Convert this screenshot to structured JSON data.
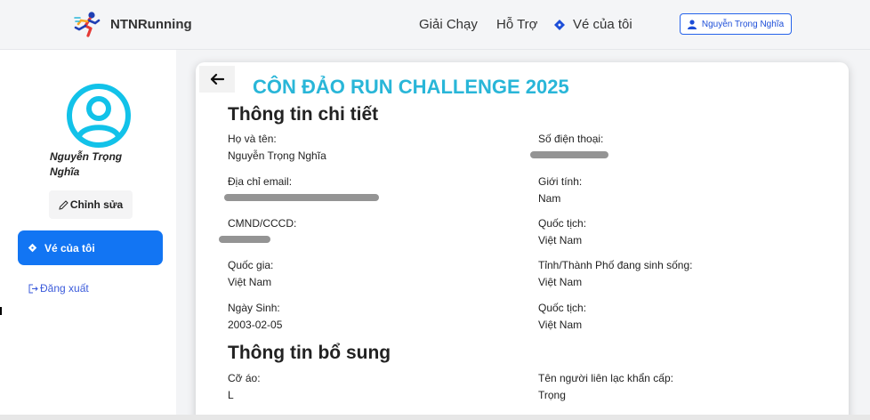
{
  "header": {
    "brand": "NTNRunning",
    "nav": {
      "races": "Giải Chạy",
      "support": "Hỗ Trợ",
      "my_tickets": "Vé của tôi"
    },
    "user_button": "Nguyễn Trọng Nghĩa"
  },
  "sidebar": {
    "user_name": "Nguyễn Trọng Nghĩa",
    "edit_label": "Chỉnh sửa",
    "my_tickets_label": "Vé của tôi",
    "logout_label": "Đăng xuất"
  },
  "card": {
    "event_title": "CÔN ĐẢO RUN CHALLENGE 2025",
    "details_title": "Thông tin chi tiết",
    "fields": {
      "full_name": {
        "label": "Họ và tên:",
        "value": "Nguyễn Trọng Nghĩa"
      },
      "phone": {
        "label": "Số điện thoại:"
      },
      "email": {
        "label": "Địa chỉ email:"
      },
      "gender": {
        "label": "Giới tính:",
        "value": "Nam"
      },
      "id_number": {
        "label": "CMND/CCCD:"
      },
      "nationality": {
        "label": "Quốc tịch:",
        "value": "Việt Nam"
      },
      "country": {
        "label": "Quốc gia:",
        "value": "Việt Nam"
      },
      "province": {
        "label": "Tỉnh/Thành Phố đang sinh sống:",
        "value": "Việt Nam"
      },
      "birthday": {
        "label": "Ngày Sinh:",
        "value": "2003-02-05"
      },
      "nationality2": {
        "label": "Quốc tịch:",
        "value": "Việt Nam"
      }
    },
    "extra_title": "Thông tin bổ sung",
    "extra_fields": {
      "shirt_size": {
        "label": "Cỡ áo:",
        "value": "L"
      },
      "emergency_contact": {
        "label": "Tên người liên lạc khẩn cấp:",
        "value": "Trọng"
      }
    }
  },
  "colors": {
    "primary": "#1275f3",
    "event_title": "#29b6d8",
    "link": "#3b5bdb"
  },
  "icons": [
    "runner-logo",
    "ticket-icon",
    "user-icon",
    "avatar-icon",
    "pencil-icon",
    "logout-icon",
    "arrow-left-icon"
  ]
}
